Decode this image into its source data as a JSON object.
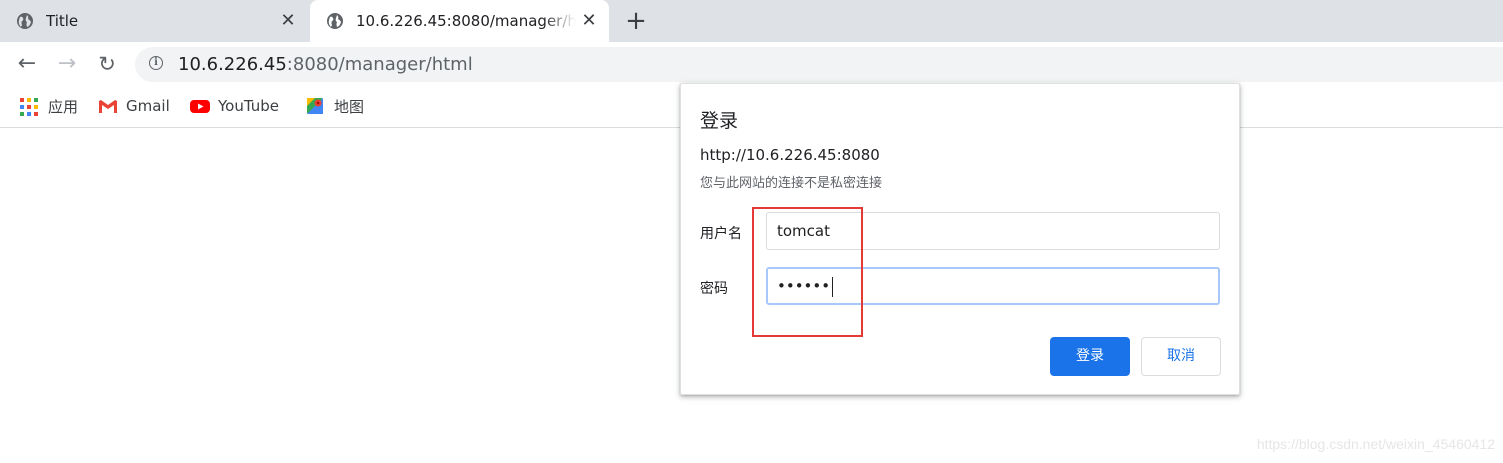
{
  "tabs": [
    {
      "title": "Title",
      "close": "✕",
      "favicon": "globe-icon"
    },
    {
      "title": "10.6.226.45:8080/manager/html",
      "close": "✕",
      "favicon": "globe-icon"
    }
  ],
  "new_tab": "+",
  "toolbar": {
    "back": "←",
    "forward": "→",
    "reload": "↻",
    "info": "i",
    "url_host": "10.6.226.45",
    "url_rest": ":8080/manager/html"
  },
  "bookmarks": [
    {
      "label": "应用",
      "icon": "apps-grid-icon"
    },
    {
      "label": "Gmail",
      "icon": "gmail-icon"
    },
    {
      "label": "YouTube",
      "icon": "youtube-icon"
    },
    {
      "label": "地图",
      "icon": "maps-icon"
    }
  ],
  "dialog": {
    "title": "登录",
    "origin": "http://10.6.226.45:8080",
    "warning": "您与此网站的连接不是私密连接",
    "username_label": "用户名",
    "username_value": "tomcat",
    "password_label": "密码",
    "password_value": "••••••",
    "login_button": "登录",
    "cancel_button": "取消"
  },
  "watermark": "https://blog.csdn.net/weixin_45460412",
  "colors": {
    "accent": "#1a73e8",
    "highlight": "#e53935",
    "tabstrip": "#dee1e6"
  }
}
